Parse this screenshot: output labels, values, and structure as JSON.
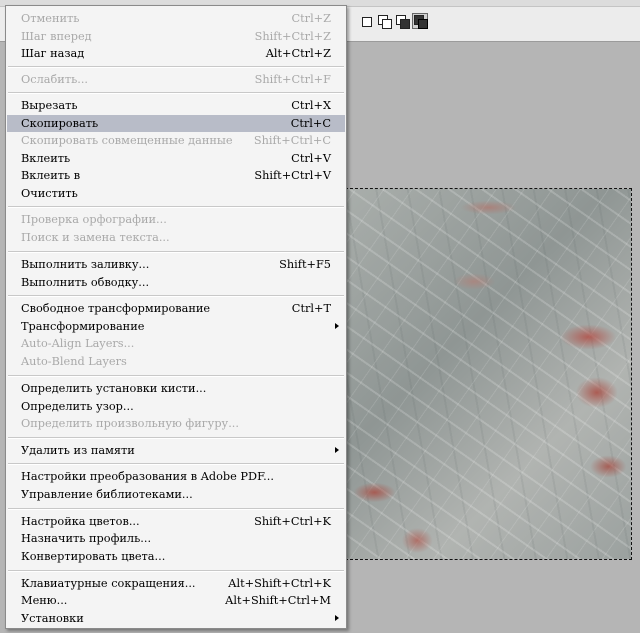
{
  "menu": {
    "undo": {
      "label": "Отменить",
      "shortcut": "Ctrl+Z"
    },
    "step_forward": {
      "label": "Шаг вперед",
      "shortcut": "Shift+Ctrl+Z"
    },
    "step_backward": {
      "label": "Шаг назад",
      "shortcut": "Alt+Ctrl+Z"
    },
    "fade": {
      "label": "Ослабить...",
      "shortcut": "Shift+Ctrl+F"
    },
    "cut": {
      "label": "Вырезать",
      "shortcut": "Ctrl+X"
    },
    "copy": {
      "label": "Скопировать",
      "shortcut": "Ctrl+C"
    },
    "copy_merged": {
      "label": "Скопировать совмещенные данные",
      "shortcut": "Shift+Ctrl+C"
    },
    "paste": {
      "label": "Вклеить",
      "shortcut": "Ctrl+V"
    },
    "paste_into": {
      "label": "Вклеить в",
      "shortcut": "Shift+Ctrl+V"
    },
    "clear": {
      "label": "Очистить"
    },
    "check_spelling": {
      "label": "Проверка орфографии..."
    },
    "find_replace": {
      "label": "Поиск и замена текста..."
    },
    "fill": {
      "label": "Выполнить заливку...",
      "shortcut": "Shift+F5"
    },
    "stroke": {
      "label": "Выполнить обводку..."
    },
    "free_transform": {
      "label": "Свободное трансформирование",
      "shortcut": "Ctrl+T"
    },
    "transform": {
      "label": "Трансформирование"
    },
    "auto_align": {
      "label": "Auto-Align Layers..."
    },
    "auto_blend": {
      "label": "Auto-Blend Layers"
    },
    "define_brush": {
      "label": "Определить установки кисти..."
    },
    "define_pattern": {
      "label": "Определить узор..."
    },
    "define_shape": {
      "label": "Определить произвольную фигуру..."
    },
    "purge": {
      "label": "Удалить из памяти"
    },
    "pdf_presets": {
      "label": "Настройки преобразования в Adobe PDF..."
    },
    "preset_manager": {
      "label": "Управление библиотеками..."
    },
    "color_settings": {
      "label": "Настройка цветов...",
      "shortcut": "Shift+Ctrl+K"
    },
    "assign_profile": {
      "label": "Назначить профиль..."
    },
    "convert_profile": {
      "label": "Конвертировать цвета..."
    },
    "keyboard_shortcuts": {
      "label": "Клавиатурные сокращения...",
      "shortcut": "Alt+Shift+Ctrl+K"
    },
    "menus": {
      "label": "Меню...",
      "shortcut": "Alt+Shift+Ctrl+M"
    },
    "preferences": {
      "label": "Установки"
    }
  },
  "colors": {
    "highlight": "#b8bcc8",
    "disabled_text": "#a9a9a9",
    "menu_bg": "#f4f4f4",
    "workspace": "#b5b5b5"
  },
  "toolbar": {
    "icons": [
      "new-selection-icon",
      "add-to-selection-icon",
      "subtract-from-selection-icon",
      "intersect-selection-icon"
    ]
  }
}
